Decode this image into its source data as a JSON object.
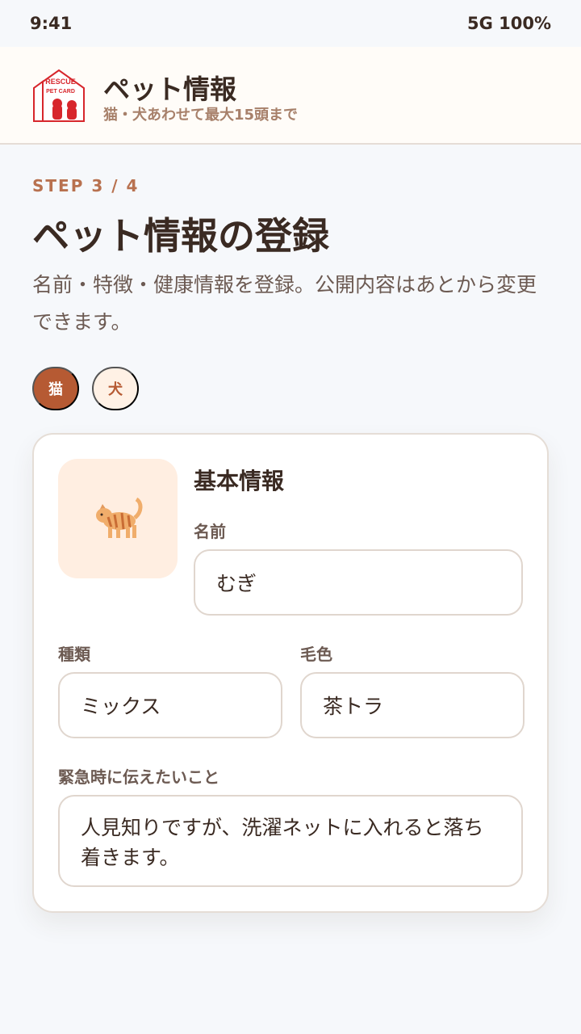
{
  "status_bar": {
    "time": "9:41",
    "right": "5G 100%"
  },
  "header": {
    "logo": {
      "icon": "rescue-pet-card-logo",
      "top_text": "RESCUE",
      "bottom_text": "PET CARD",
      "color": "#d7262c"
    },
    "title": "ペット情報",
    "subtitle": "猫・犬あわせて最大15頭まで"
  },
  "step": {
    "label": "STEP 3 / 4",
    "title": "ペット情報の登録",
    "description": "名前・特徴・健康情報を登録。公開内容はあとから変更できます。"
  },
  "pet_tabs": [
    {
      "label": "猫",
      "selected": true
    },
    {
      "label": "犬",
      "selected": false
    }
  ],
  "card": {
    "photo_icon": "cat-icon",
    "photo_glyph": "🐈",
    "section_title": "基本情報",
    "name": {
      "label": "名前",
      "value": "むぎ"
    },
    "kind": {
      "label": "種類",
      "value": "ミックス"
    },
    "color": {
      "label": "毛色",
      "value": "茶トラ"
    },
    "emergency_note": {
      "label": "緊急時に伝えたいこと",
      "value": "人見知りですが、洗濯ネットに入れると落ち着きます。"
    }
  },
  "colors": {
    "accent": "#b65a33",
    "accent_light": "#fff1e5",
    "text": "#3a2a22",
    "muted": "#6c5a52"
  }
}
